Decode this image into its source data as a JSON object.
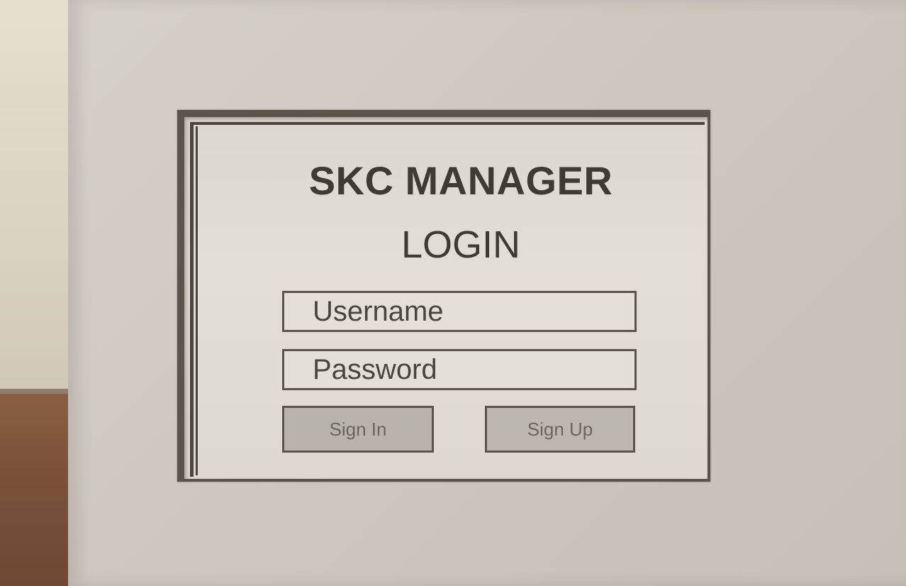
{
  "screen": {
    "title": "SKC MANAGER",
    "subtitle": "LOGIN"
  },
  "form": {
    "username_placeholder": "Username",
    "password_placeholder": "Password",
    "sign_in_label": "Sign In",
    "sign_up_label": "Sign Up"
  },
  "colors": {
    "ink": "#3f3a33",
    "paper": "#e2ded6",
    "housing": "#cdc7be",
    "button": "#b9b4ab"
  }
}
